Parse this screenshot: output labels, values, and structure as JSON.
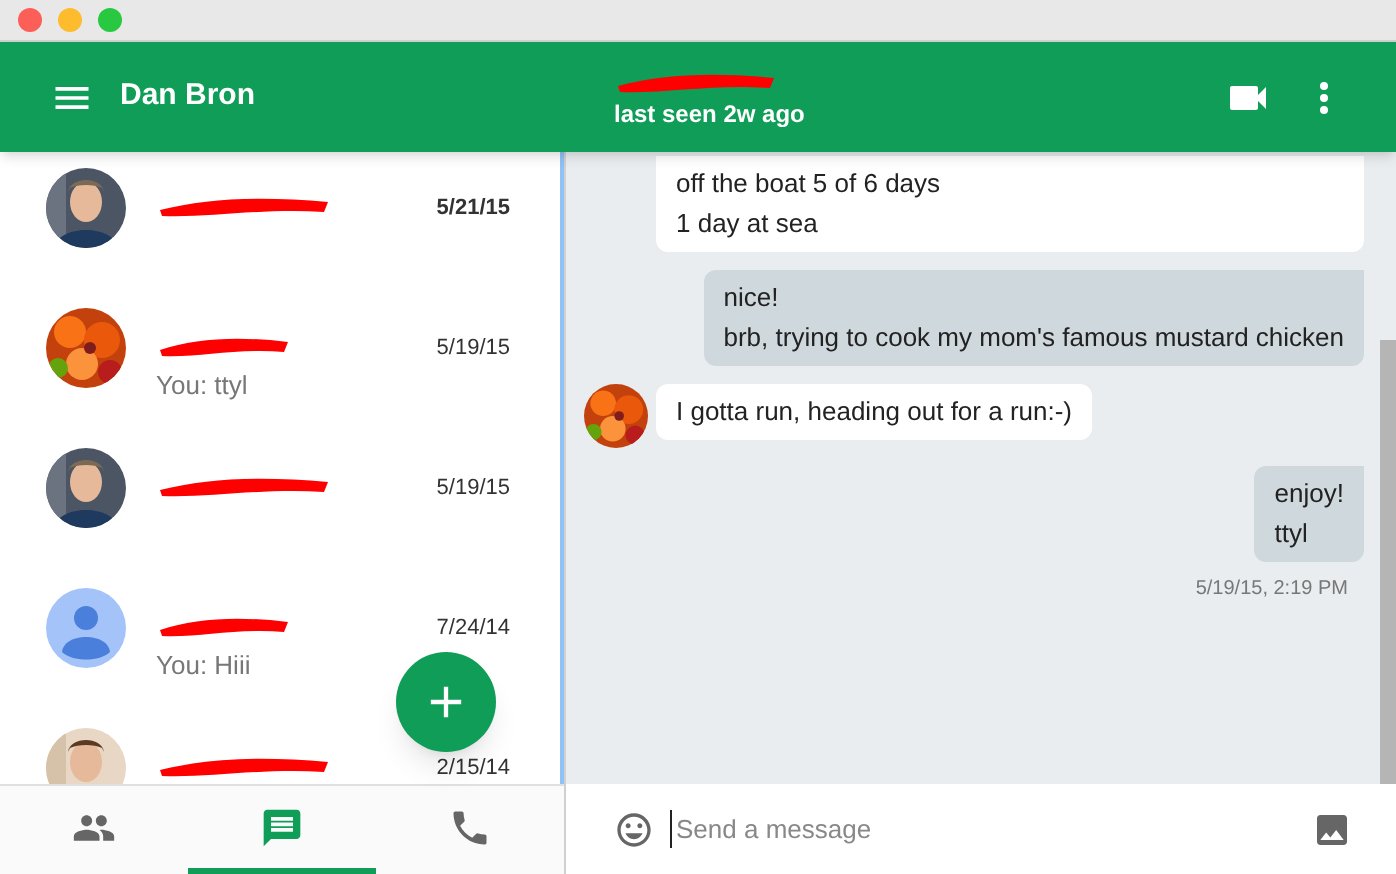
{
  "sidebar": {
    "user_name": "Dan Bron",
    "contacts": [
      {
        "date": "5/21/15",
        "unread": true
      },
      {
        "kind": "flowers",
        "preview": "You: ttyl",
        "date": "5/19/15",
        "unread": false
      },
      {
        "date": "5/19/15",
        "unread": false
      },
      {
        "kind": "default",
        "preview": "You: Hiii",
        "date": "7/24/14",
        "unread": false
      },
      {
        "kind": "photo2",
        "date": "2/15/14",
        "unread": false
      }
    ],
    "nav_tabs": [
      {
        "kind": "people",
        "selected": false
      },
      {
        "kind": "messages",
        "selected": true
      },
      {
        "kind": "phone",
        "selected": false
      }
    ]
  },
  "conversation": {
    "status": "last seen 2w ago",
    "messages": [
      {
        "kind": "incoming",
        "avatar": false,
        "lines": [
          "off the boat 5 of 6 days",
          "1 day at sea"
        ]
      },
      {
        "kind": "outgoing",
        "lines": [
          "nice!",
          "brb, trying to cook my mom's famous mustard chicken"
        ]
      },
      {
        "kind": "incoming",
        "avatar": true,
        "lines": [
          "I gotta run, heading out for a run:-)"
        ]
      },
      {
        "kind": "outgoing",
        "lines": [
          "enjoy!",
          "ttyl"
        ],
        "timestamp": "5/19/15, 2:19 PM"
      }
    ],
    "composer": {
      "placeholder": "Send a message"
    }
  }
}
